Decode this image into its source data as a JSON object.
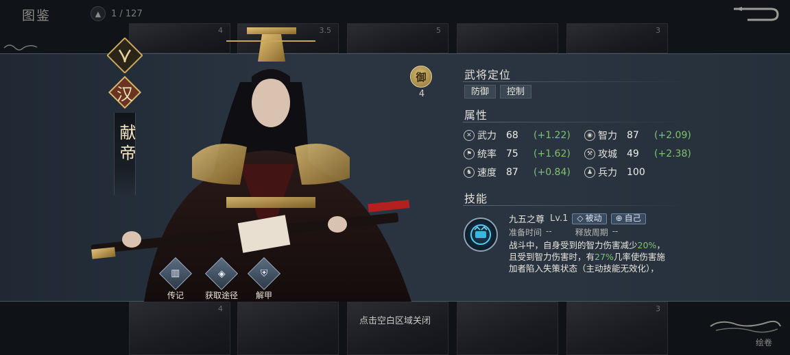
{
  "gallery": {
    "title": "图鉴",
    "counter": "1 / 127",
    "top_card_numbers": [
      "4",
      "3.5",
      "5",
      "",
      "",
      "3"
    ],
    "bottom_card_numbers": [
      "4",
      "",
      "",
      "",
      "3"
    ],
    "scroll_label": "绘卷"
  },
  "hero": {
    "kingdom": "汉",
    "name": "献帝",
    "role_badge": "御",
    "cost": "4"
  },
  "role_section": {
    "title": "武将定位",
    "tags": [
      "防御",
      "控制"
    ]
  },
  "attributes_section": {
    "title": "属性",
    "stats": [
      {
        "name": "武力",
        "value": "68",
        "growth": "(+1.22)",
        "icon": "sword-icon"
      },
      {
        "name": "智力",
        "value": "87",
        "growth": "(+2.09)",
        "icon": "brain-icon"
      },
      {
        "name": "统率",
        "value": "75",
        "growth": "(+1.62)",
        "icon": "command-icon"
      },
      {
        "name": "攻城",
        "value": "49",
        "growth": "(+2.38)",
        "icon": "siege-icon"
      },
      {
        "name": "速度",
        "value": "87",
        "growth": "(+0.84)",
        "icon": "horse-icon"
      },
      {
        "name": "兵力",
        "value": "100",
        "growth": "",
        "icon": "troops-icon"
      }
    ]
  },
  "skills_section": {
    "title": "技能",
    "skill": {
      "name": "九五之尊",
      "level": "Lv.1",
      "type_tag": "被动",
      "target_tag": "自己",
      "prep_label": "准备时间",
      "prep_value": "--",
      "cooldown_label": "释放周期",
      "cooldown_value": "--",
      "desc_1": "战斗中，自身受到的智力伤害减少",
      "desc_pct_1": "20%",
      "desc_2": "，且受到智力伤害时，有",
      "desc_pct_2": "27%",
      "desc_3": "几率使伤害施加者陷入失策状态（主动技能无效化），"
    }
  },
  "actions": [
    {
      "label": "传记",
      "icon": "book-icon"
    },
    {
      "label": "获取途径",
      "icon": "map-icon"
    },
    {
      "label": "解甲",
      "icon": "armor-icon"
    }
  ],
  "close_hint": "点击空白区域关闭",
  "colors": {
    "growth_green": "#7ec26c",
    "panel_bg": "#2a3541",
    "gold": "#d8bf7a"
  }
}
